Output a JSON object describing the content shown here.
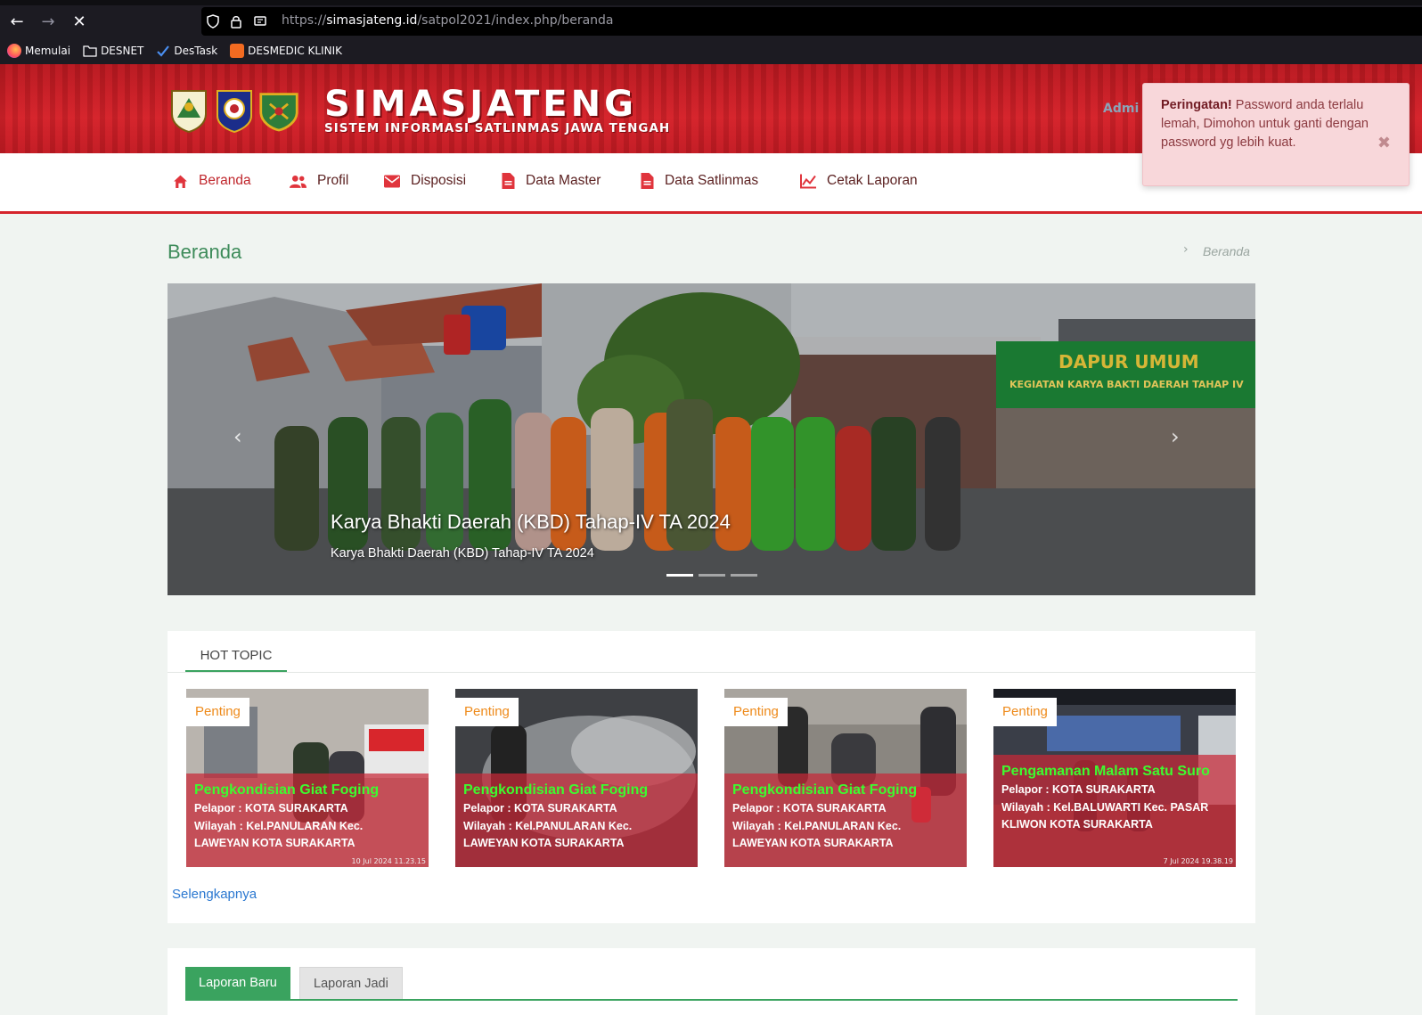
{
  "browser": {
    "url_prefix": "https://",
    "url_domain": "simasjateng.id",
    "url_path": "/satpol2021/index.php/beranda",
    "bookmarks": [
      "Memulai",
      "DESNET",
      "DesTask",
      "DESMEDIC KLINIK"
    ]
  },
  "header": {
    "brand_title": "SIMASJATENG",
    "brand_subtitle": "SISTEM INFORMASI SATLINMAS JAWA TENGAH",
    "admin_label": "Admi"
  },
  "menu": [
    {
      "label": "Beranda",
      "icon": "home-icon",
      "active": true
    },
    {
      "label": "Profil",
      "icon": "users-icon"
    },
    {
      "label": "Disposisi",
      "icon": "mail-icon"
    },
    {
      "label": "Data Master",
      "icon": "document-icon"
    },
    {
      "label": "Data Satlinmas",
      "icon": "document-icon"
    },
    {
      "label": "Cetak Laporan",
      "icon": "chart-icon"
    }
  ],
  "toast": {
    "title": "Peringatan!",
    "message": "Password anda terlalu lemah, Dimohon untuk ganti dengan password yg lebih kuat.",
    "close": "✖"
  },
  "page": {
    "title": "Beranda",
    "breadcrumb": "Beranda",
    "breadcrumb_sep": "›"
  },
  "carousel": {
    "caption_title": "Karya Bhakti Daerah (KBD) Tahap-IV TA 2024",
    "caption_sub": "Karya Bhakti Daerah (KBD) Tahap-IV TA 2024",
    "banner_text": "DAPUR UMUM",
    "banner_sub": "KEGIATAN KARYA BAKTI DAERAH TAHAP IV",
    "prev": "‹",
    "next": "›"
  },
  "hot_topic": {
    "tab_label": "HOT TOPIC",
    "more_label": "Selengkapnya",
    "cards": [
      {
        "badge": "Penting",
        "title": "Pengkondisian Giat Foging",
        "reporter": "Pelapor : KOTA SURAKARTA",
        "region": "Wilayah : Kel.PANULARAN Kec. LAWEYAN KOTA SURAKARTA",
        "stamp": "10 Jul 2024 11.23.15"
      },
      {
        "badge": "Penting",
        "title": "Pengkondisian Giat Foging",
        "reporter": "Pelapor : KOTA SURAKARTA",
        "region": "Wilayah : Kel.PANULARAN Kec. LAWEYAN KOTA SURAKARTA",
        "stamp": ""
      },
      {
        "badge": "Penting",
        "title": "Pengkondisian Giat Foging",
        "reporter": "Pelapor : KOTA SURAKARTA",
        "region": "Wilayah : Kel.PANULARAN Kec. LAWEYAN KOTA SURAKARTA",
        "stamp": ""
      },
      {
        "badge": "Penting",
        "title": "Pengamanan Malam Satu Suro",
        "reporter": "Pelapor : KOTA SURAKARTA",
        "region": "Wilayah : Kel.BALUWARTI Kec. PASAR KLIWON KOTA SURAKARTA",
        "stamp": "7 Jul 2024 19.38.19"
      }
    ]
  },
  "laporan": {
    "tab_new": "Laporan Baru",
    "tab_done": "Laporan Jadi"
  },
  "colors": {
    "brand_red": "#d5242c",
    "accent_green": "#3aa35f",
    "badge_orange": "#ee8a1a",
    "card_title_green": "#3dfb2f"
  }
}
